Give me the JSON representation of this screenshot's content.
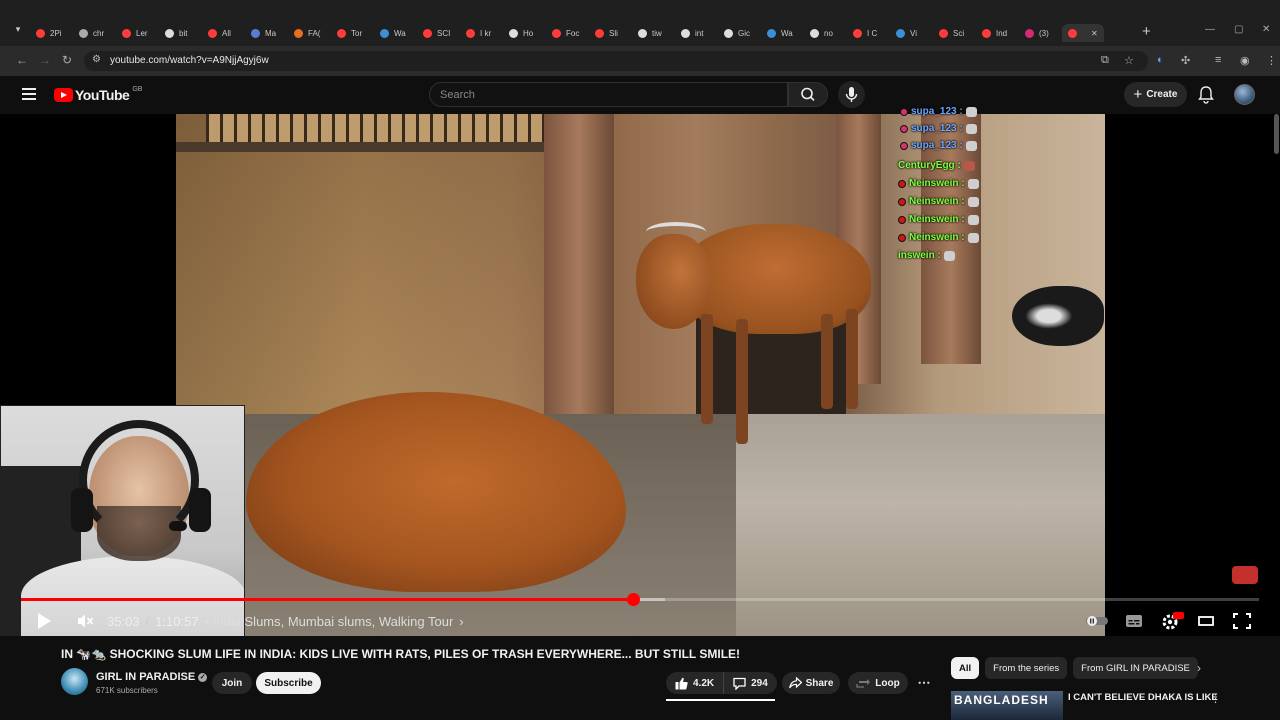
{
  "browser": {
    "tabs": [
      {
        "label": "2Pi",
        "color": "#ff3b3b"
      },
      {
        "label": "chr",
        "color": "#aaaaaa"
      },
      {
        "label": "Ler",
        "color": "#ff3b3b"
      },
      {
        "label": "bit",
        "color": "#dddddd"
      },
      {
        "label": "All",
        "color": "#ff3b3b"
      },
      {
        "label": "Ma",
        "color": "#5b7bd6"
      },
      {
        "label": "FA(",
        "color": "#e86f1f"
      },
      {
        "label": "Tor",
        "color": "#ff3b3b"
      },
      {
        "label": "Wa",
        "color": "#3a8fd6"
      },
      {
        "label": "SCI",
        "color": "#ff3b3b"
      },
      {
        "label": "I kr",
        "color": "#ff3b3b"
      },
      {
        "label": "Ho",
        "color": "#dddddd"
      },
      {
        "label": "Foc",
        "color": "#ff3b3b"
      },
      {
        "label": "Sli",
        "color": "#ff3b3b"
      },
      {
        "label": "tiw",
        "color": "#dddddd"
      },
      {
        "label": "int",
        "color": "#dddddd"
      },
      {
        "label": "Gic",
        "color": "#dddddd"
      },
      {
        "label": "Wa",
        "color": "#3a8fd6"
      },
      {
        "label": "no",
        "color": "#dddddd"
      },
      {
        "label": "I C",
        "color": "#ff3b3b"
      },
      {
        "label": "Vi",
        "color": "#3a8fd6"
      },
      {
        "label": "Sci",
        "color": "#ff3b3b"
      },
      {
        "label": "Ind",
        "color": "#ff3b3b"
      },
      {
        "label": "(3)",
        "color": "#d62976"
      },
      {
        "label": "",
        "color": "#ff3b3b",
        "active": true
      }
    ],
    "url": "youtube.com/watch?v=A9NjjAgyj6w"
  },
  "youtube": {
    "logo_text": "YouTube",
    "country_code": "GB",
    "search_placeholder": "Search",
    "create_label": "Create"
  },
  "chat": [
    {
      "user": "supa_123 :",
      "color": "#6aa6ff",
      "badge": "pink"
    },
    {
      "user": "supa_123 :",
      "color": "#6aa6ff",
      "badge": "pink"
    },
    {
      "user": "supa_123 :",
      "color": "#6aa6ff",
      "badge": "pink"
    },
    {
      "user": "CenturyEgg :",
      "color": "#7cff3c",
      "badge": "none"
    },
    {
      "user": "Neinswein :",
      "color": "#7cff3c",
      "badge": "red"
    },
    {
      "user": "Neinswein :",
      "color": "#7cff3c",
      "badge": "red"
    },
    {
      "user": "Neinswein :",
      "color": "#7cff3c",
      "badge": "red"
    },
    {
      "user": "Neinswein :",
      "color": "#7cff3c",
      "badge": "red"
    },
    {
      "user": "inswein :",
      "color": "#7cff3c",
      "badge": "none"
    }
  ],
  "player": {
    "current_time": "35:03",
    "duration": "1:10:57",
    "chapter": "• India Slums, Mumbai slums, Walking Tour",
    "progress_fraction": 0.494,
    "buffer_fraction": 0.52
  },
  "video": {
    "title_prefix": "IN 🐄🐀",
    "title": "SHOCKING SLUM LIFE IN INDIA: KIDS LIVE WITH RATS, PILES OF TRASH EVERYWHERE... BUT STILL SMILE!",
    "channel": "GIRL IN PARADISE",
    "subscribers": "671K subscribers",
    "join_label": "Join",
    "subscribe_label": "Subscribe",
    "likes": "4.2K",
    "comments": "294",
    "share_label": "Share",
    "loop_label": "Loop"
  },
  "sidebar": {
    "chips": [
      {
        "label": "All",
        "active": true
      },
      {
        "label": "From the series",
        "active": false
      },
      {
        "label": "From GIRL IN PARADISE",
        "active": false
      }
    ],
    "rec_thumb_text": "BANGLADESH",
    "rec_title": "I CAN'T BELIEVE DHAKA IS LIKE"
  },
  "colors": {
    "accent": "#ff0000",
    "background": "#0f0f0f",
    "chip_bg": "#272727"
  }
}
